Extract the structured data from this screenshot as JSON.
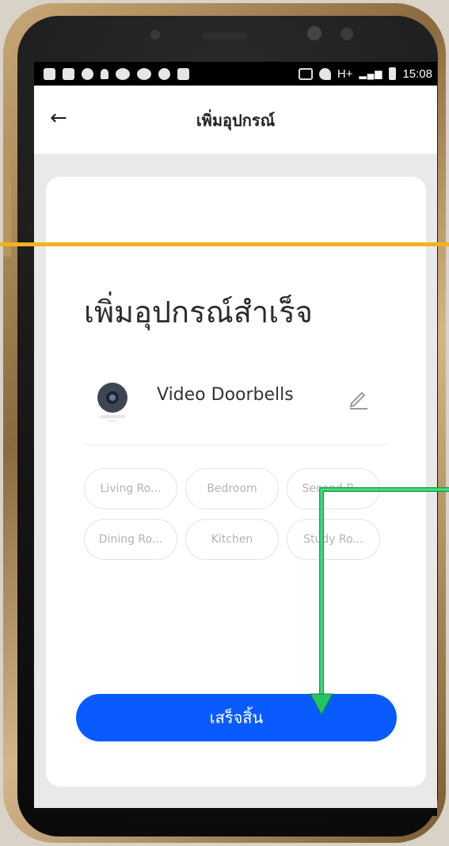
{
  "status_bar": {
    "network": "H+",
    "time": "15:08"
  },
  "app_bar": {
    "title": "เพิ่มอุปกรณ์"
  },
  "success": {
    "heading": "เพิ่มอุปกรณ์สำเร็จ"
  },
  "device": {
    "name": "Video Doorbells"
  },
  "rooms": [
    {
      "label": "Living Ro..."
    },
    {
      "label": "Bedroom"
    },
    {
      "label": "Second B..."
    },
    {
      "label": "Dining Ro..."
    },
    {
      "label": "Kitchen"
    },
    {
      "label": "Study Ro..."
    }
  ],
  "actions": {
    "done_label": "เสร็จสิ้น"
  },
  "colors": {
    "primary": "#0A5BFF",
    "annotation_line": "#F3B21B",
    "annotation_arrow": "#22C55E"
  }
}
